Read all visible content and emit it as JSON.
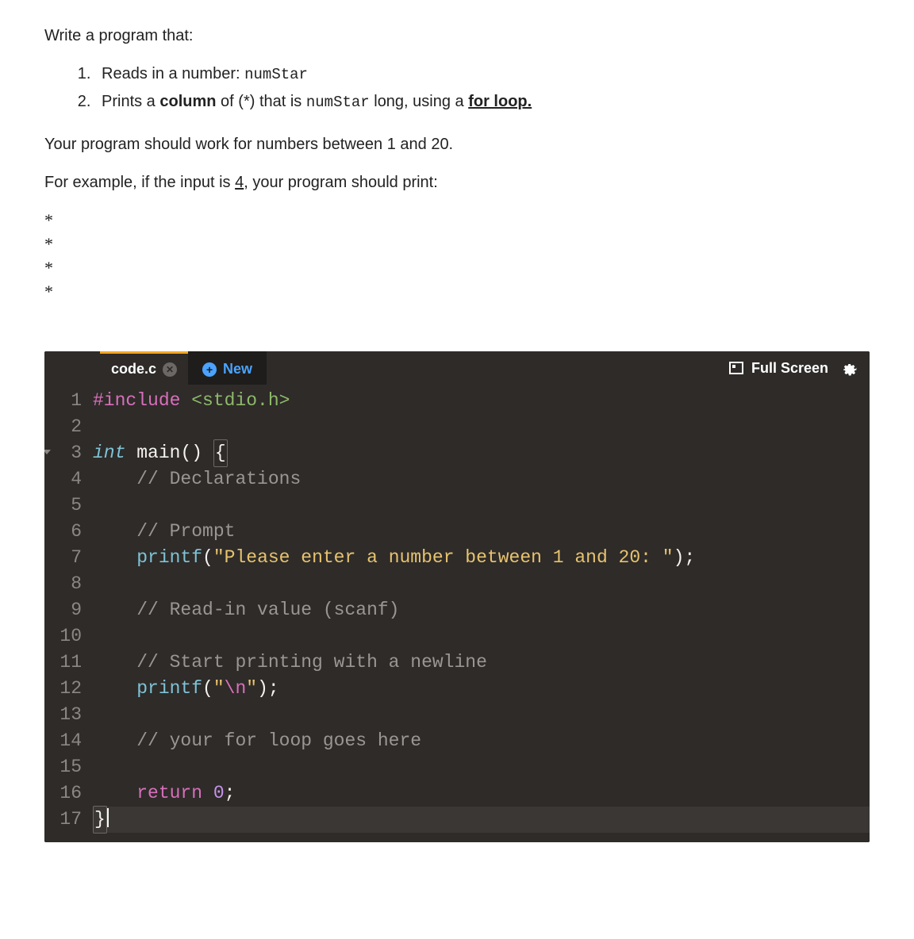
{
  "instructions": {
    "intro": "Write a program that:",
    "step1_prefix": "Reads in a number: ",
    "step1_code": "numStar",
    "step2_prefix": "Prints a ",
    "step2_bold": "column",
    "step2_mid": " of (*) that is ",
    "step2_code": "numStar",
    "step2_after_code": " long, using a ",
    "step2_underline": "for loop.",
    "constraint": "Your program should work for numbers between 1 and 20.",
    "example_prefix": "For example, if the input is ",
    "example_value": "4",
    "example_suffix": ", your program should print:",
    "output_lines": [
      "*",
      "*",
      "*",
      "*"
    ]
  },
  "editor": {
    "tab_name": "code.c",
    "new_tab_label": "New",
    "fullscreen_label": "Full Screen",
    "lines": [
      {
        "n": 1,
        "tokens": [
          {
            "t": "#include ",
            "c": "tok-preproc"
          },
          {
            "t": "<stdio.h>",
            "c": "tok-include"
          }
        ]
      },
      {
        "n": 2,
        "tokens": []
      },
      {
        "n": 3,
        "fold": true,
        "tokens": [
          {
            "t": "int",
            "c": "tok-type"
          },
          {
            "t": " ",
            "c": ""
          },
          {
            "t": "main",
            "c": "tok-ident"
          },
          {
            "t": "() ",
            "c": "tok-ident"
          },
          {
            "t": "{",
            "c": "tok-brace brace-hl"
          }
        ]
      },
      {
        "n": 4,
        "tokens": [
          {
            "t": "    ",
            "c": ""
          },
          {
            "t": "// Declarations",
            "c": "tok-comment"
          }
        ]
      },
      {
        "n": 5,
        "tokens": []
      },
      {
        "n": 6,
        "tokens": [
          {
            "t": "    ",
            "c": ""
          },
          {
            "t": "// Prompt",
            "c": "tok-comment"
          }
        ]
      },
      {
        "n": 7,
        "tokens": [
          {
            "t": "    ",
            "c": ""
          },
          {
            "t": "printf",
            "c": "tok-func"
          },
          {
            "t": "(",
            "c": "tok-ident"
          },
          {
            "t": "\"Please enter a number between 1 and 20: \"",
            "c": "tok-string"
          },
          {
            "t": ");",
            "c": "tok-ident"
          }
        ]
      },
      {
        "n": 8,
        "tokens": []
      },
      {
        "n": 9,
        "tokens": [
          {
            "t": "    ",
            "c": ""
          },
          {
            "t": "// Read-in value (scanf)",
            "c": "tok-comment"
          }
        ]
      },
      {
        "n": 10,
        "tokens": []
      },
      {
        "n": 11,
        "tokens": [
          {
            "t": "    ",
            "c": ""
          },
          {
            "t": "// Start printing with a newline",
            "c": "tok-comment"
          }
        ]
      },
      {
        "n": 12,
        "tokens": [
          {
            "t": "    ",
            "c": ""
          },
          {
            "t": "printf",
            "c": "tok-func"
          },
          {
            "t": "(",
            "c": "tok-ident"
          },
          {
            "t": "\"",
            "c": "tok-string"
          },
          {
            "t": "\\n",
            "c": "tok-escape"
          },
          {
            "t": "\"",
            "c": "tok-string"
          },
          {
            "t": ");",
            "c": "tok-ident"
          }
        ]
      },
      {
        "n": 13,
        "tokens": []
      },
      {
        "n": 14,
        "tokens": [
          {
            "t": "    ",
            "c": ""
          },
          {
            "t": "// your for loop goes here",
            "c": "tok-comment"
          }
        ]
      },
      {
        "n": 15,
        "tokens": []
      },
      {
        "n": 16,
        "tokens": [
          {
            "t": "    ",
            "c": ""
          },
          {
            "t": "return",
            "c": "tok-keyword"
          },
          {
            "t": " ",
            "c": ""
          },
          {
            "t": "0",
            "c": "tok-number"
          },
          {
            "t": ";",
            "c": "tok-ident"
          }
        ]
      },
      {
        "n": 17,
        "active": true,
        "tokens": [
          {
            "t": "}",
            "c": "tok-brace brace-hl"
          }
        ],
        "cursor": true
      }
    ]
  }
}
